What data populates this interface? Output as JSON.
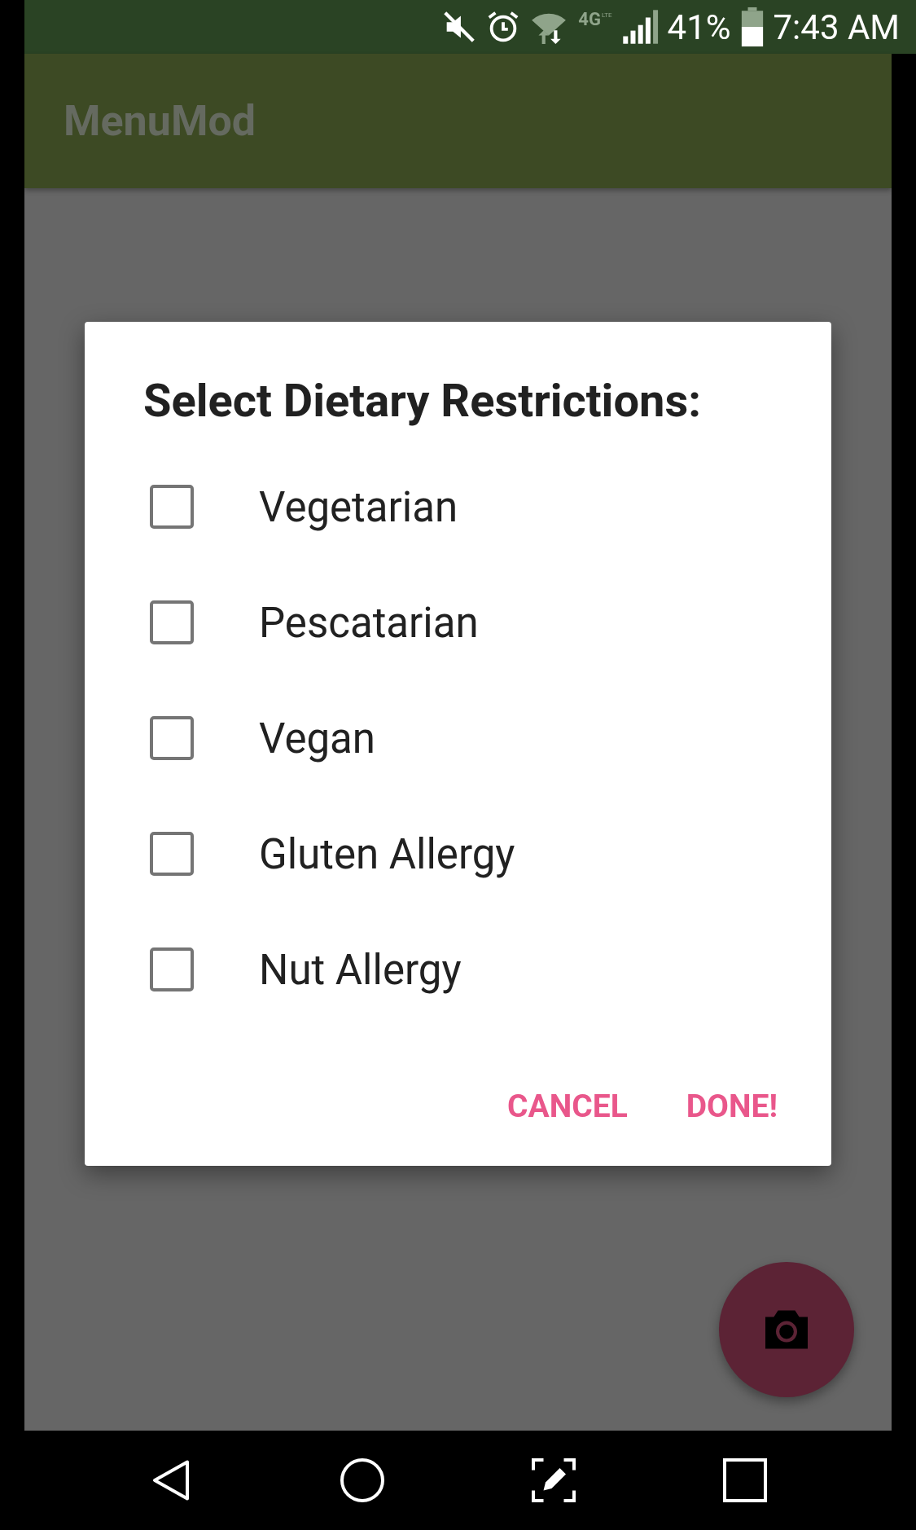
{
  "status_bar": {
    "network": "4G",
    "network_sub": "LTE",
    "battery": "41%",
    "time": "7:43 AM"
  },
  "app_bar": {
    "title": "MenuMod"
  },
  "dialog": {
    "title": "Select Dietary Restrictions:",
    "options": [
      {
        "label": "Vegetarian",
        "checked": false
      },
      {
        "label": "Pescatarian",
        "checked": false
      },
      {
        "label": "Vegan",
        "checked": false
      },
      {
        "label": "Gluten Allergy",
        "checked": false
      },
      {
        "label": "Nut Allergy",
        "checked": false
      }
    ],
    "buttons": [
      {
        "label": "CANCEL",
        "kind": "cancel"
      },
      {
        "label": "DONE!",
        "kind": "confirm"
      }
    ]
  },
  "fab": {
    "kind": "camera"
  }
}
